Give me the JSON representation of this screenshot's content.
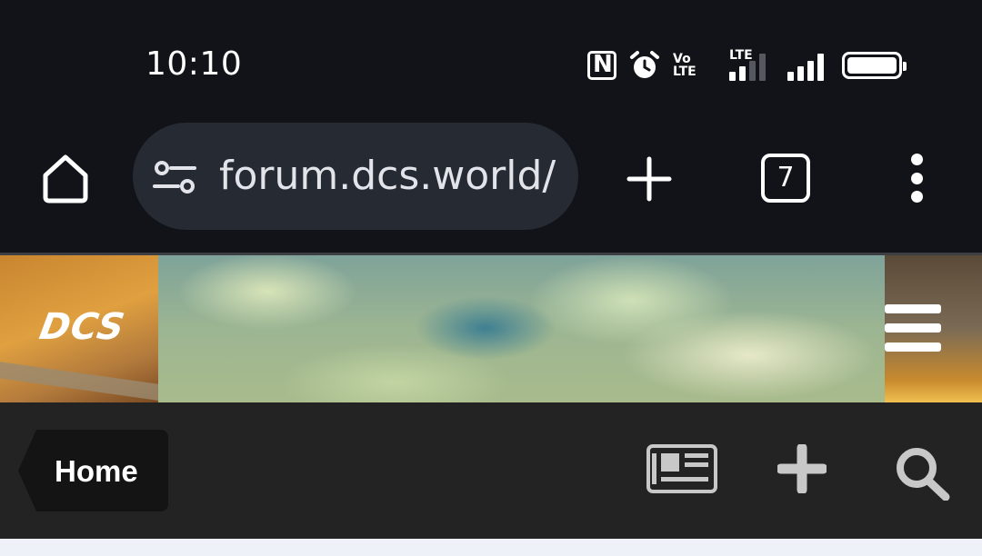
{
  "status_bar": {
    "time": "10:10",
    "volte_label_top": "Vo",
    "volte_label_bottom": "LTE",
    "lte_label": "LTE",
    "icons": [
      "nfc-icon",
      "alarm-icon",
      "volte-icon",
      "lte-signal-icon",
      "signal-icon",
      "battery-icon"
    ]
  },
  "browser": {
    "url": "forum.dcs.world/",
    "tab_count": "7",
    "icons": [
      "home-icon",
      "tune-icon",
      "plus-icon",
      "tabs-icon",
      "more-vert-icon"
    ]
  },
  "site_header": {
    "logo_text": "DCS",
    "icons": [
      "hamburger-menu-icon"
    ]
  },
  "forum_nav": {
    "breadcrumb_home": "Home",
    "icons": [
      "newspaper-icon",
      "plus-icon",
      "search-icon"
    ]
  },
  "colors": {
    "browser_bg": "#111318",
    "url_pill_bg": "#252a33",
    "nav_bg": "#232323",
    "breadcrumb_bg": "#141414",
    "nav_icon_color": "#c8c8c8",
    "page_bg": "#eef2f8"
  }
}
